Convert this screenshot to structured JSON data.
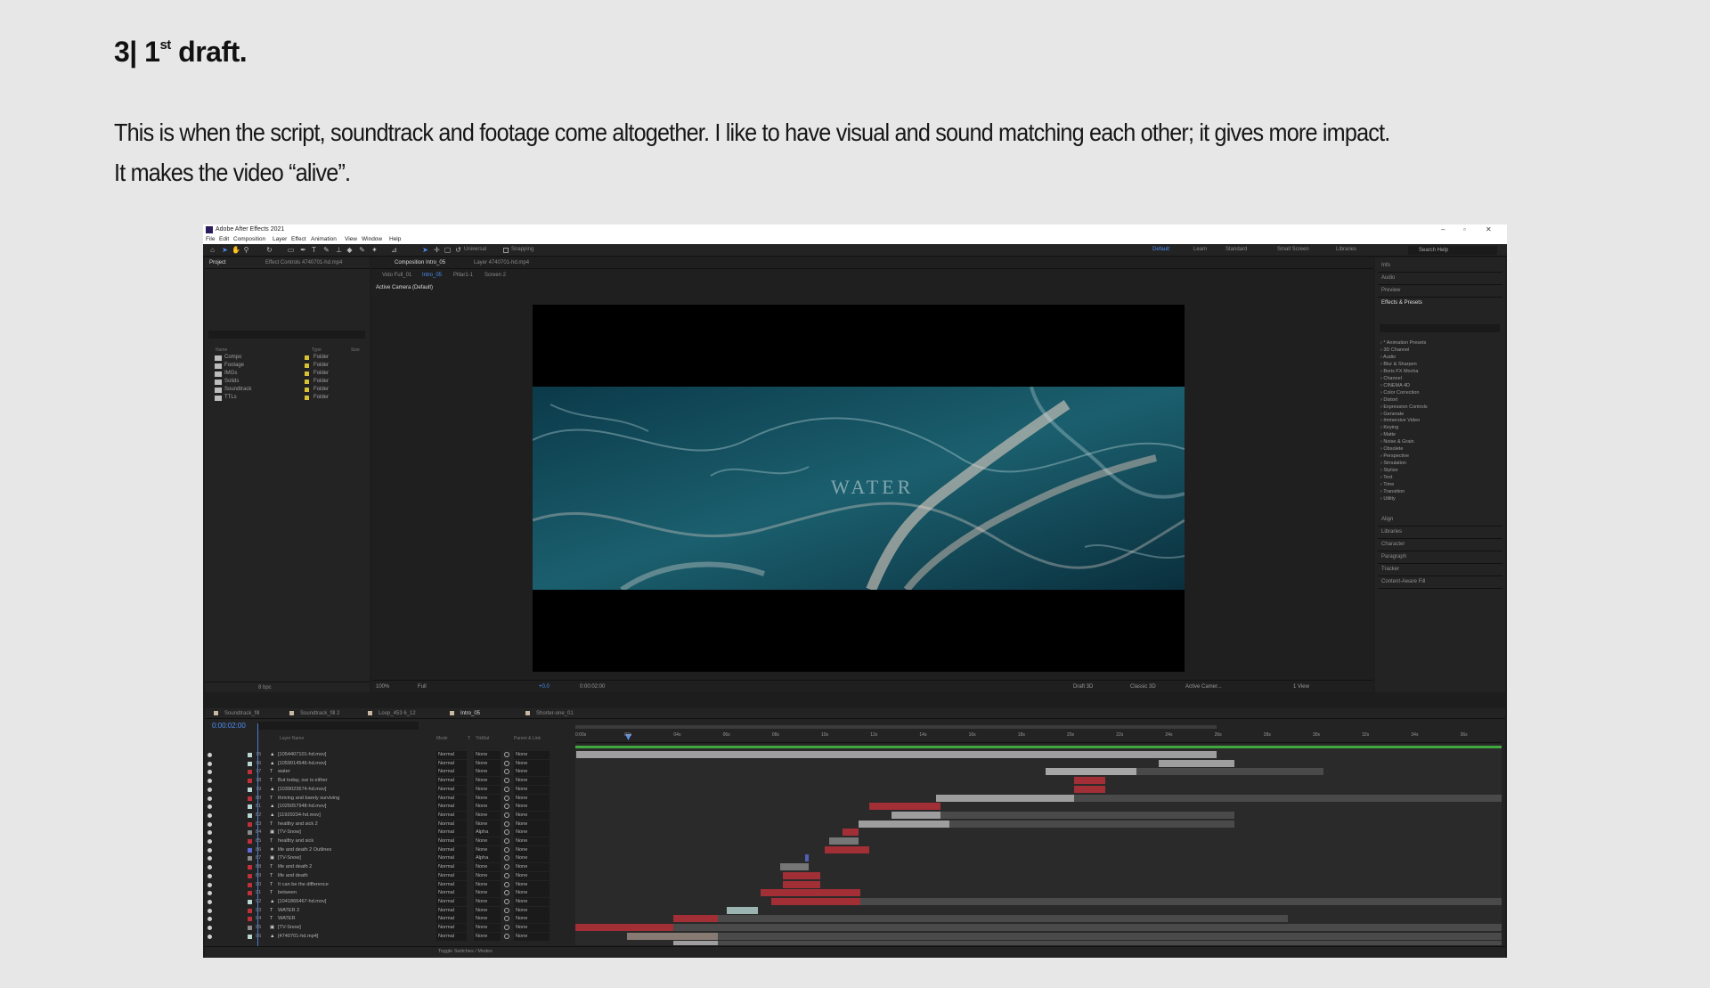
{
  "heading": {
    "main": "3| 1",
    "sup": "st",
    "rest": " draft."
  },
  "paragraph": {
    "line1": "This is when the script, soundtrack and footage come altogether. I like to have visual and sound matching each other; it gives more impact.",
    "line2": "It makes the video “alive”."
  },
  "app": {
    "title": "Adobe After Effects 2021",
    "menu": [
      "File",
      "Edit",
      "Composition",
      "Layer",
      "Effect",
      "Animation",
      "View",
      "Window",
      "Help"
    ],
    "toolbar": {
      "universal": "Universal",
      "snapping": "Snapping"
    },
    "workspaces": [
      "Default",
      "Learn",
      "Standard",
      "Small Screen",
      "Libraries"
    ],
    "search_help": "Search Help",
    "project": {
      "tab_project": "Project",
      "tab_effect_controls": "Effect Controls 4740701-hd.mp4",
      "columns": [
        "Name",
        "Type",
        "Size"
      ],
      "items": [
        {
          "name": "Compo",
          "type": "Folder"
        },
        {
          "name": "Footage",
          "type": "Folder"
        },
        {
          "name": "IMGs",
          "type": "Folder"
        },
        {
          "name": "Solids",
          "type": "Folder"
        },
        {
          "name": "Soundtrack",
          "type": "Folder"
        },
        {
          "name": "TTLs",
          "type": "Folder"
        }
      ],
      "footer_bpc": "8 bpc"
    },
    "comp": {
      "tab": "Composition Intro_05",
      "layer_tab": "Layer 4740701-hd.mp4",
      "breadcrumbs": [
        "Vido Full_01",
        "Intro_05",
        "Pillar1-1",
        "Screen 2"
      ],
      "active_camera": "Active Camera (Default)",
      "overlay_text": "WATER",
      "footer": {
        "zoom": "100%",
        "resolution": "Full",
        "exposure": "+0.0",
        "time": "0:00:02:00",
        "renderer": "Draft 3D",
        "renderer_mode": "Classic 3D",
        "camera": "Active Camer...",
        "views": "1 View"
      }
    },
    "right": {
      "top": [
        "Info",
        "Audio",
        "Preview"
      ],
      "effects_title": "Effects & Presets",
      "effects": [
        "* Animation Presets",
        "3D Channel",
        "Audio",
        "Blur & Sharpen",
        "Boris FX Mocha",
        "Channel",
        "CINEMA 4D",
        "Color Correction",
        "Distort",
        "Expression Controls",
        "Generate",
        "Immersive Video",
        "Keying",
        "Matte",
        "Noise & Grain",
        "Obsolete",
        "Perspective",
        "Simulation",
        "Stylize",
        "Text",
        "Time",
        "Transition",
        "Utility"
      ],
      "bottom": [
        "Align",
        "Libraries",
        "Character",
        "Paragraph",
        "Tracker",
        "Content-Aware Fill"
      ]
    },
    "timeline": {
      "tabs": [
        {
          "name": "Soundtrack_fill",
          "color": "#c8b9a0"
        },
        {
          "name": "Soundtrack_fill 2",
          "color": "#c8b9a0"
        },
        {
          "name": "Loop_453 6_12",
          "color": "#c8b9a0"
        },
        {
          "name": "Intro_05",
          "color": "#c8b9a0"
        },
        {
          "name": "Shorter-one_01",
          "color": "#c8b9a0"
        }
      ],
      "timecode": "0:00:02:00",
      "ruler": [
        "0:00s",
        "02s",
        "04s",
        "06s",
        "08s",
        "10s",
        "12s",
        "14s",
        "16s",
        "18s",
        "20s",
        "22s",
        "24s",
        "26s",
        "28s",
        "30s",
        "32s",
        "34s",
        "36s"
      ],
      "header": [
        "Layer Name",
        "Mode",
        "T",
        "TrkMat",
        "Parent & Link"
      ],
      "layers": [
        {
          "num": "75",
          "icon": "▲",
          "name": "[1054407101-hd.mov]",
          "mode": "Normal",
          "trk": "None",
          "parent": "None",
          "color": "#b8d7d3"
        },
        {
          "num": "76",
          "icon": "▲",
          "name": "[1059014546-hd.mov]",
          "mode": "Normal",
          "trk": "None",
          "parent": "None",
          "color": "#b8d7d3"
        },
        {
          "num": "77",
          "icon": "T",
          "name": "water",
          "mode": "Normal",
          "trk": "None",
          "parent": "None",
          "color": "#c0303a"
        },
        {
          "num": "78",
          "icon": "T",
          "name": "But today, our        is either",
          "mode": "Normal",
          "trk": "None",
          "parent": "None",
          "color": "#c0303a"
        },
        {
          "num": "79",
          "icon": "▲",
          "name": "[1039023674-hd.mov]",
          "mode": "Normal",
          "trk": "None",
          "parent": "None",
          "color": "#b8d7d3"
        },
        {
          "num": "80",
          "icon": "T",
          "name": "thriving and barely surviving",
          "mode": "Normal",
          "trk": "None",
          "parent": "None",
          "color": "#c0303a"
        },
        {
          "num": "81",
          "icon": "▲",
          "name": "[1025057948-hd.mov]",
          "mode": "Normal",
          "trk": "None",
          "parent": "None",
          "color": "#b8d7d3"
        },
        {
          "num": "82",
          "icon": "▲",
          "name": "[11929234-hd.mov]",
          "mode": "Normal",
          "trk": "None",
          "parent": "None",
          "color": "#b8d7d3"
        },
        {
          "num": "83",
          "icon": "T",
          "name": "healthy and sick 2",
          "mode": "Normal",
          "trk": "None",
          "parent": "None",
          "color": "#c0303a"
        },
        {
          "num": "84",
          "icon": "▣",
          "name": "[TV-Snow]",
          "mode": "Normal",
          "trk": "Alpha",
          "parent": "None",
          "color": "#8a8a8a"
        },
        {
          "num": "85",
          "icon": "T",
          "name": "healthy and sick",
          "mode": "Normal",
          "trk": "None",
          "parent": "None",
          "color": "#c0303a"
        },
        {
          "num": "86",
          "icon": "★",
          "name": "life and death 2 Outlines",
          "mode": "Normal",
          "trk": "None",
          "parent": "None",
          "color": "#5c6bd8"
        },
        {
          "num": "87",
          "icon": "▣",
          "name": "[TV-Snow]",
          "mode": "Normal",
          "trk": "Alpha",
          "parent": "None",
          "color": "#8a8a8a"
        },
        {
          "num": "88",
          "icon": "T",
          "name": "life and death 2",
          "mode": "Normal",
          "trk": "None",
          "parent": "None",
          "color": "#c0303a"
        },
        {
          "num": "89",
          "icon": "T",
          "name": "life and death",
          "mode": "Normal",
          "trk": "None",
          "parent": "None",
          "color": "#c0303a"
        },
        {
          "num": "90",
          "icon": "T",
          "name": "It can be the difference",
          "mode": "Normal",
          "trk": "None",
          "parent": "None",
          "color": "#c0303a"
        },
        {
          "num": "91",
          "icon": "T",
          "name": "between",
          "mode": "Normal",
          "trk": "None",
          "parent": "None",
          "color": "#c0303a"
        },
        {
          "num": "92",
          "icon": "▲",
          "name": "[1041866467-hd.mov]",
          "mode": "Normal",
          "trk": "None",
          "parent": "None",
          "color": "#b8d7d3"
        },
        {
          "num": "93",
          "icon": "T",
          "name": "WATER 2",
          "mode": "Normal",
          "trk": "None",
          "parent": "None",
          "color": "#c0303a"
        },
        {
          "num": "94",
          "icon": "T",
          "name": "WATER",
          "mode": "Normal",
          "trk": "None",
          "parent": "None",
          "color": "#c0303a"
        },
        {
          "num": "95",
          "icon": "▣",
          "name": "[TV-Snow]",
          "mode": "Normal",
          "trk": "None",
          "parent": "None",
          "color": "#8a8a8a"
        },
        {
          "num": "96",
          "icon": "▲",
          "name": "[4740701-hd.mp4]",
          "mode": "Normal",
          "trk": "None",
          "parent": "None",
          "color": "#b8d7d3"
        }
      ],
      "toggle_label": "Toggle Switches / Modes"
    }
  }
}
